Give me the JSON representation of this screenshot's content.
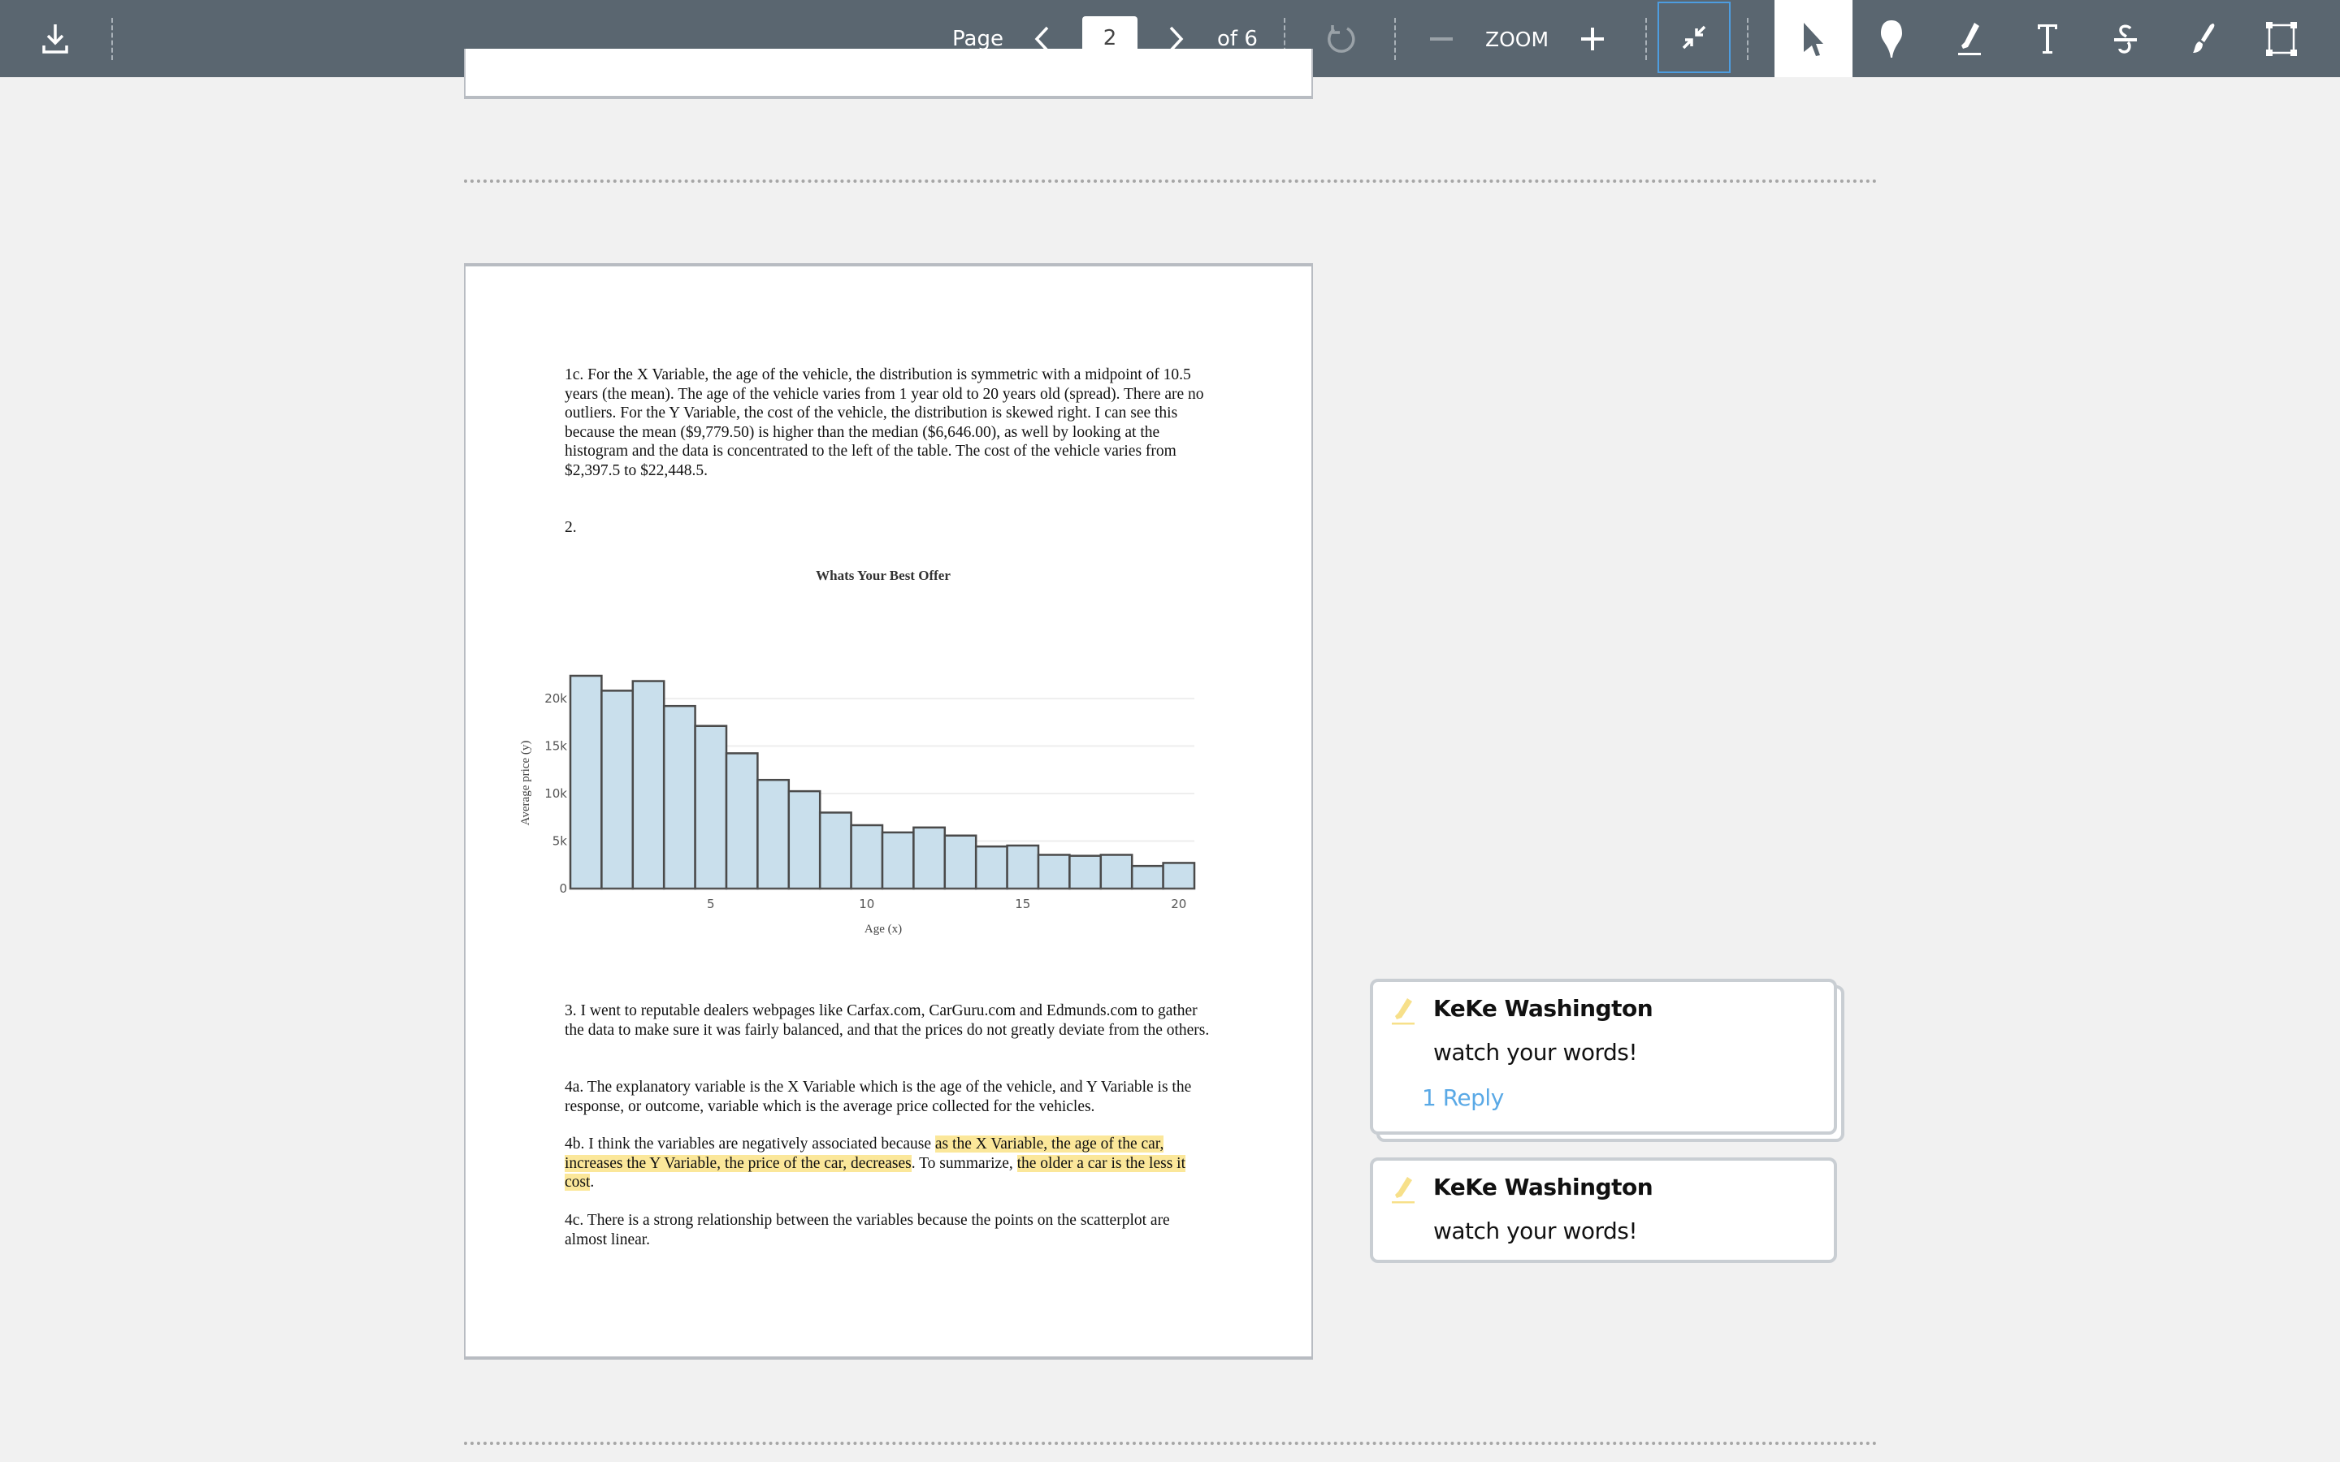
{
  "toolbar": {
    "download_icon": "download-icon",
    "page_label": "Page",
    "current_page": "2",
    "total_pages_label": "of 6",
    "zoom_label": "ZOOM",
    "colors": {
      "background": "#5a6670",
      "active_outline": "#4d9de0",
      "active_tool_bg": "#ffffff"
    },
    "tools": [
      {
        "name": "select",
        "icon": "cursor-arrow-icon",
        "active": true
      },
      {
        "name": "comment",
        "icon": "comment-pin-icon"
      },
      {
        "name": "highlight",
        "icon": "highlighter-icon"
      },
      {
        "name": "text",
        "icon": "text-t-icon"
      },
      {
        "name": "strikethrough",
        "icon": "strikethrough-icon"
      },
      {
        "name": "draw",
        "icon": "brush-icon"
      },
      {
        "name": "area",
        "icon": "area-select-icon"
      }
    ]
  },
  "document": {
    "paragraph_1c": "1c. For the X Variable, the age of the vehicle, the distribution is symmetric with a midpoint of 10.5 years (the mean). The age of the vehicle varies from 1 year old to 20 years old (spread). There are no outliers. For the Y Variable, the cost of the vehicle, the distribution is skewed right. I can see this because the mean ($9,779.50) is higher than the median ($6,646.00), as well by looking at the histogram and the data is concentrated to the left of the table. The cost of the vehicle varies from $2,397.5 to $22,448.5.",
    "label_2": "2.",
    "paragraph_3": "3. I went to reputable dealers webpages like Carfax.com, CarGuru.com and Edmunds.com to gather the data to make sure it was fairly balanced, and that the prices do not greatly deviate from the others.",
    "paragraph_4a": "4a. The explanatory variable is the X Variable which is the age of the vehicle, and Y Variable is the response, or outcome, variable which is the average price collected for the vehicles.",
    "paragraph_4b": {
      "part1": "4b. I think the variables are negatively associated because ",
      "highlight1": "as the X Variable, the age of the car, increases the Y Variable, the price of the car, decreases",
      "part2": ". To summarize, ",
      "highlight2": "the older a car is the less it cost",
      "part3": "."
    },
    "paragraph_4c": "4c. There is a strong relationship between the variables because the points on the scatterplot are almost linear.",
    "highlight_color": "#fbe79a"
  },
  "chart_data": {
    "type": "bar",
    "title": "Whats Your Best Offer",
    "xlabel": "Age (x)",
    "ylabel": "Average price (y)",
    "x": [
      1,
      2,
      3,
      4,
      5,
      6,
      7,
      8,
      9,
      10,
      11,
      12,
      13,
      14,
      15,
      16,
      17,
      18,
      19,
      20
    ],
    "values": [
      22400,
      20830,
      21840,
      19220,
      17120,
      14240,
      11440,
      10250,
      8000,
      6670,
      5910,
      6430,
      5580,
      4430,
      4530,
      3550,
      3450,
      3550,
      2380,
      2700
    ],
    "x_ticks": [
      5,
      10,
      15,
      20
    ],
    "x_tick_labels": [
      "5",
      "10",
      "15",
      "20"
    ],
    "y_ticks": [
      0,
      5000,
      10000,
      15000,
      20000
    ],
    "y_tick_labels": [
      "0",
      "5k",
      "10k",
      "15k",
      "20k"
    ],
    "xlim": [
      0.5,
      20.5
    ],
    "ylim": [
      0,
      22400
    ],
    "grid": true,
    "bar_color": "#c9dfec",
    "bar_edge_color": "#4a4a4a"
  },
  "comments": [
    {
      "icon": "highlighter-icon",
      "author": "KeKe Washington",
      "text": "watch your words!",
      "replies_label": "1 Reply",
      "stacked": true
    },
    {
      "icon": "highlighter-icon",
      "author": "KeKe Washington",
      "text": "watch your words!"
    }
  ]
}
